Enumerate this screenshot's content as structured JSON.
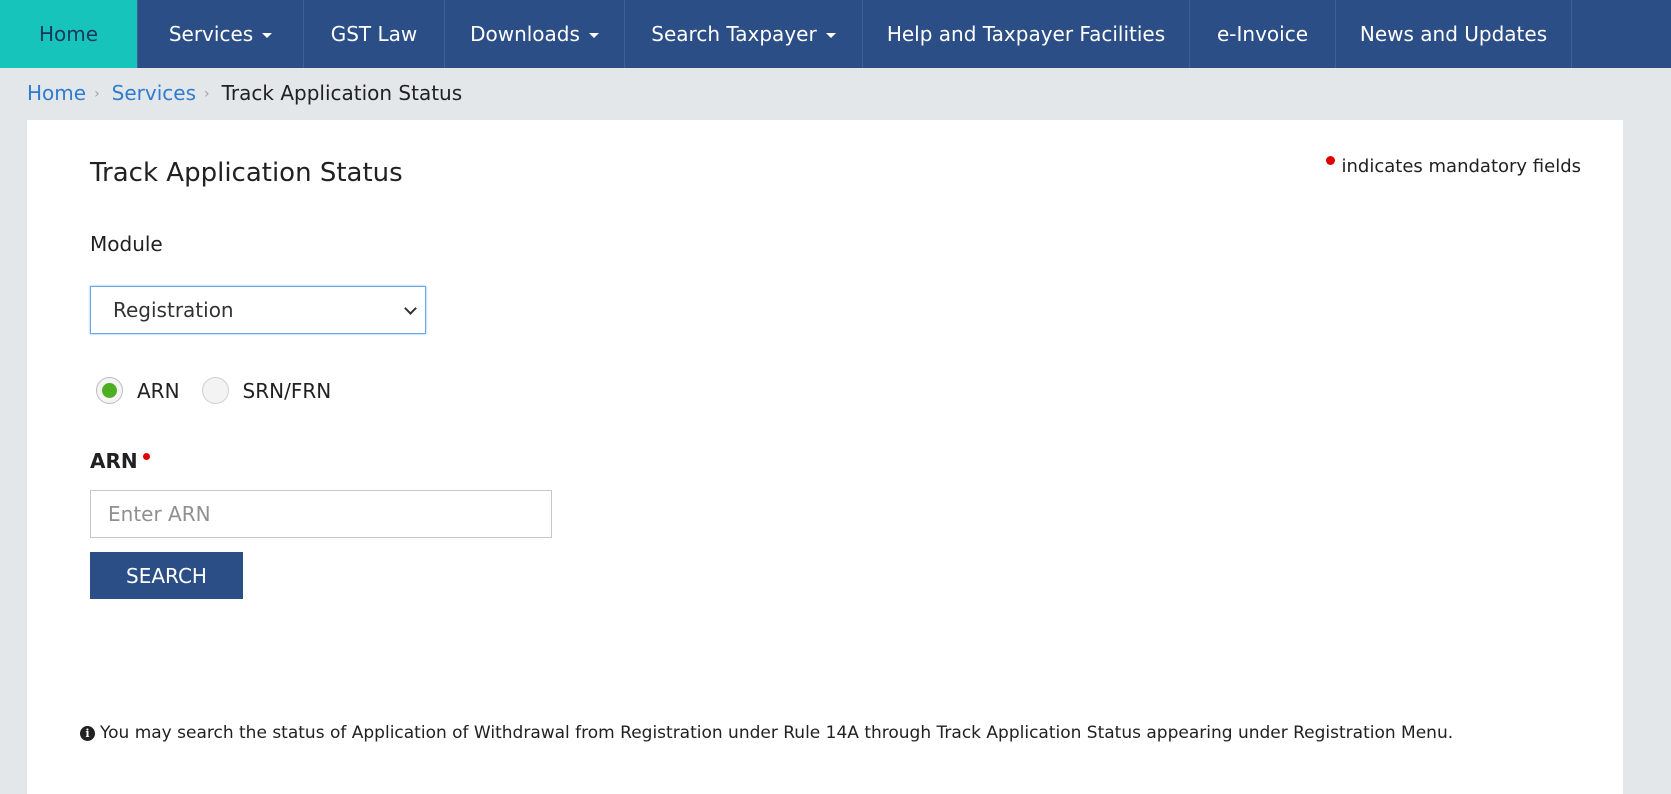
{
  "nav": {
    "items": [
      {
        "label": "Home",
        "active": true,
        "dropdown": false
      },
      {
        "label": "Services",
        "active": false,
        "dropdown": true
      },
      {
        "label": "GST Law",
        "active": false,
        "dropdown": false
      },
      {
        "label": "Downloads",
        "active": false,
        "dropdown": true
      },
      {
        "label": "Search Taxpayer",
        "active": false,
        "dropdown": true
      },
      {
        "label": "Help and Taxpayer Facilities",
        "active": false,
        "dropdown": false
      },
      {
        "label": "e-Invoice",
        "active": false,
        "dropdown": false
      },
      {
        "label": "News and Updates",
        "active": false,
        "dropdown": false
      }
    ]
  },
  "breadcrumb": {
    "home": "Home",
    "services": "Services",
    "current": "Track Application Status"
  },
  "form": {
    "title": "Track Application Status",
    "mandatory_note": "indicates mandatory fields",
    "module_label": "Module",
    "module_selected": "Registration",
    "radio_options": [
      {
        "label": "ARN",
        "checked": true
      },
      {
        "label": "SRN/FRN",
        "checked": false
      }
    ],
    "arn_label": "ARN",
    "arn_placeholder": "Enter ARN",
    "arn_value": "",
    "search_button": "SEARCH"
  },
  "info": {
    "text": "You may search the status of Application of Withdrawal from Registration under Rule 14A through Track Application Status appearing under Registration Menu."
  },
  "icons": {
    "info": "info-circle-icon",
    "mandatory": "red-dot-icon",
    "caret": "caret-down-icon",
    "breadcrumb_separator": "chevron-right-icon"
  },
  "colors": {
    "nav_bg": "#2c4e86",
    "nav_active": "#17c4bb",
    "link": "#2f7bd0",
    "radio_checked": "#4cae21",
    "mandatory": "#e00000",
    "button_bg": "#2c4e86"
  }
}
